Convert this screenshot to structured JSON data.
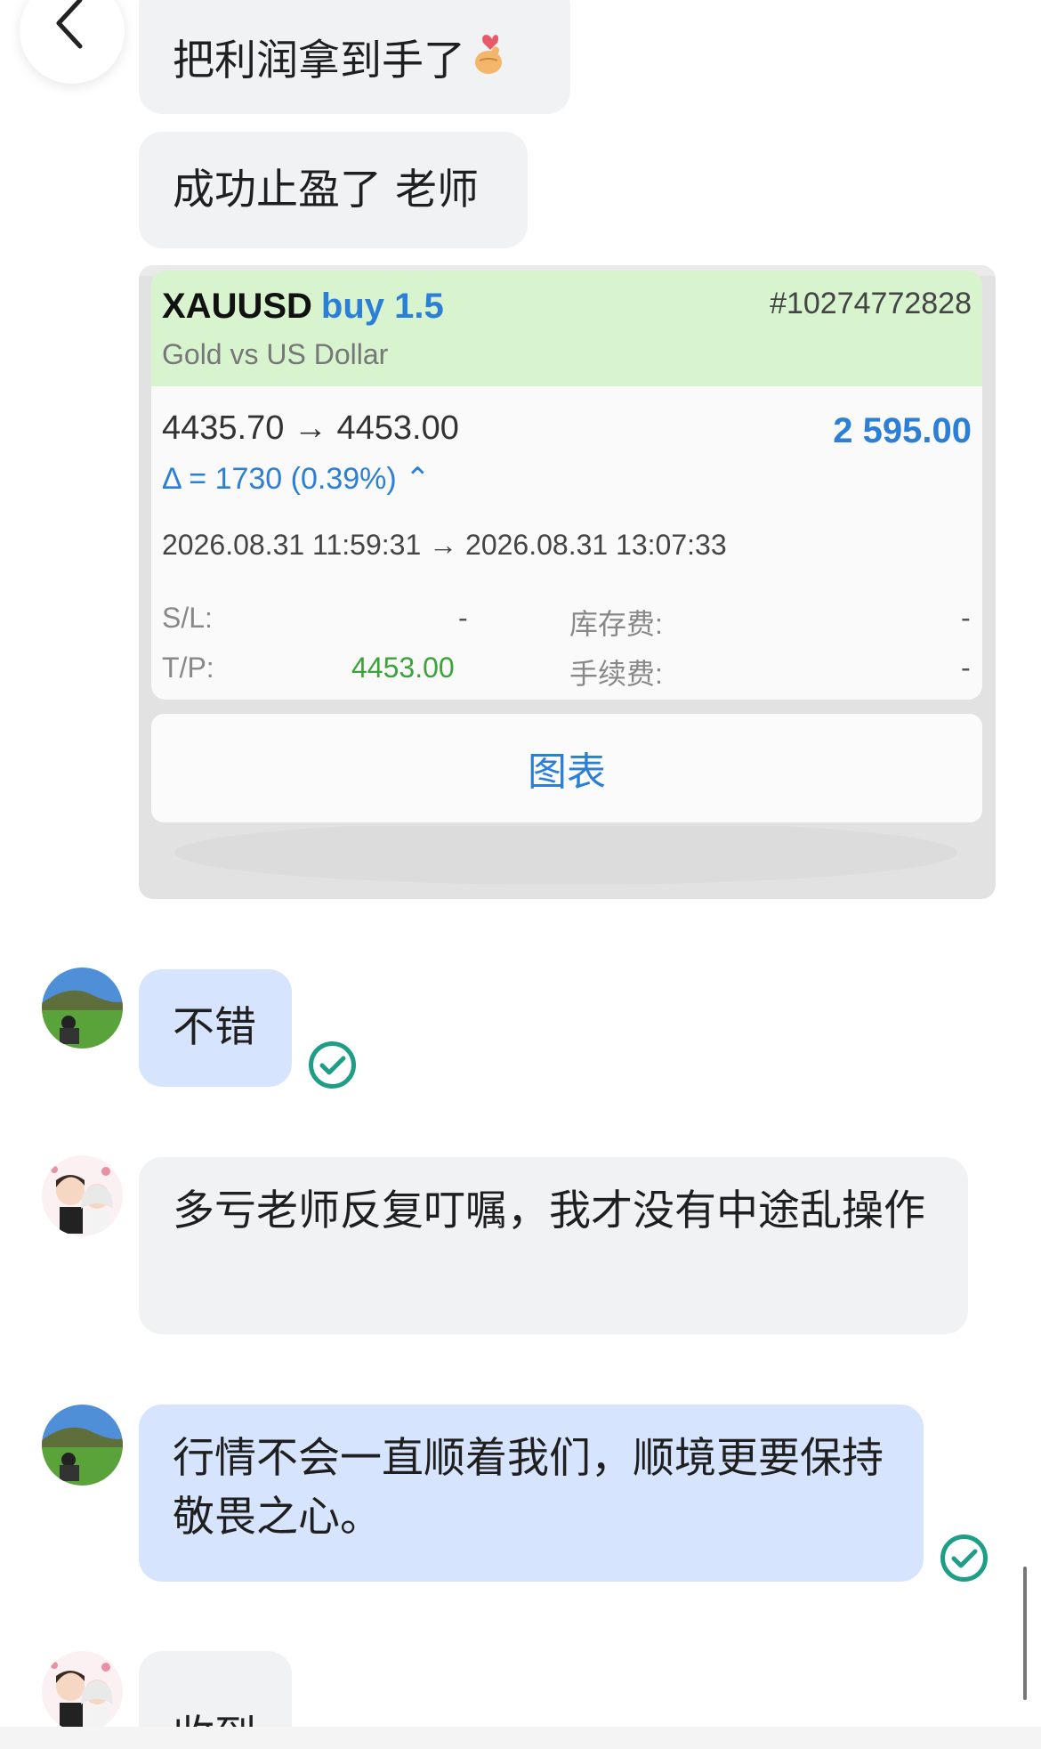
{
  "messages": {
    "m1": {
      "text": "把利润拿到手了",
      "emoji": "finger-heart"
    },
    "m2": {
      "text": "成功止盈了 老师"
    },
    "m4": {
      "text": "不错"
    },
    "m5": {
      "text": "多亏老师反复叮嘱，我才没有中途乱操作"
    },
    "m6": {
      "text": "行情不会一直顺着我们，顺境更要保持敬畏之心。"
    },
    "m7": {
      "text": "收到"
    }
  },
  "trade_card": {
    "symbol": "XAUUSD",
    "side": "buy 1.5",
    "ticket": "#10274772828",
    "description": "Gold vs US Dollar",
    "price": "4435.70 → 4453.00",
    "profit": "2 595.00",
    "delta": "Δ = 1730 (0.39%) ⌃",
    "time": "2026.08.31 11:59:31 → 2026.08.31 13:07:33",
    "sl_label": "S/L:",
    "sl_value": "-",
    "tp_label": "T/P:",
    "tp_value": "4453.00",
    "swap_label": "库存费:",
    "swap_value": "-",
    "commission_label": "手续费:",
    "commission_value": "-",
    "chart_button": "图表"
  },
  "colors": {
    "sent_bubble": "#d6e4fd",
    "received_bubble": "#f1f2f4",
    "read_check": "#1e9e86",
    "accent_blue": "#2b7fd6"
  },
  "icons": {
    "back": "chevron-left-icon",
    "read": "check-circle-icon"
  }
}
